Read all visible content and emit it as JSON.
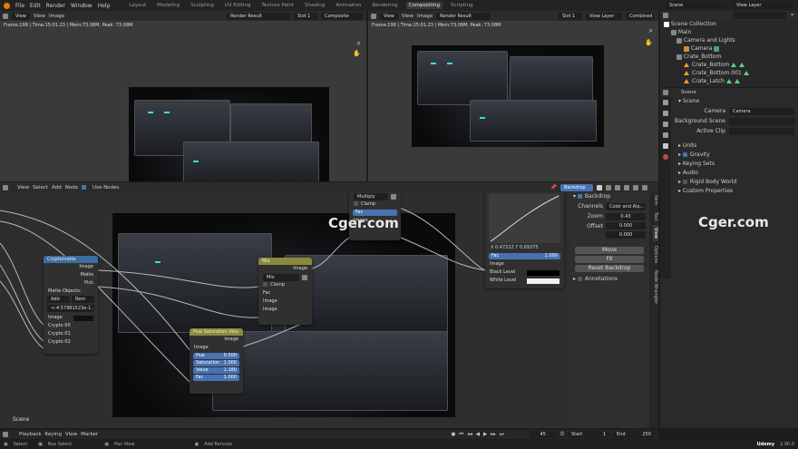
{
  "topbar": {
    "menus": [
      "File",
      "Edit",
      "Render",
      "Window",
      "Help"
    ],
    "workspaces": [
      "Layout",
      "Modeling",
      "Sculpting",
      "UV Editing",
      "Texture Paint",
      "Shading",
      "Animation",
      "Rendering",
      "Compositing",
      "Scripting"
    ],
    "active_workspace": "Compositing",
    "scene": "Scene",
    "view_layer": "View Layer"
  },
  "left_image_editor": {
    "view": "View",
    "menu_view": "View",
    "menu_image": "Image",
    "image_name": "Render Result",
    "slot": "Slot 1",
    "layer": "Composite",
    "status": "Frame:199 | Time:15:01.23 | Mem:73.08M, Peak: 73.08M"
  },
  "right_image_editor": {
    "view": "View",
    "menu_view": "View",
    "menu_image": "Image",
    "image_name": "Render Result",
    "slot": "Slot 1",
    "layer": "View Layer",
    "pass": "Combined",
    "status": "Frame:199 | Time:15:01.23 | Mem:73.08M, Peak: 73.08M"
  },
  "outliner": {
    "title": "Scene Collection",
    "items": [
      "Main",
      "Camera and Lights",
      "Camera",
      "Crate_Bottom",
      "Crate_Bottom",
      "Crate_Bottom.001",
      "Crate_Latch"
    ]
  },
  "properties": {
    "scene_label": "Scene",
    "section": "Scene",
    "camera_label": "Camera",
    "camera_value": "Camera",
    "bg_scene_label": "Background Scene",
    "active_clip_label": "Active Clip",
    "panels": [
      "Units",
      "Gravity",
      "Keying Sets",
      "Audio",
      "Rigid Body World",
      "Custom Properties"
    ]
  },
  "node_editor": {
    "menus": [
      "View",
      "Select",
      "Add",
      "Node"
    ],
    "use_nodes": "Use Nodes",
    "backdrop_btn": "Backdrop",
    "scene_label": "Scene",
    "multiply_node": {
      "title": "Multiply",
      "clamp": "Clamp",
      "fac": "Fac",
      "image": "Image"
    },
    "mix_node": {
      "title": "Mix",
      "output": "Image",
      "mode": "Mix",
      "clamp": "Clamp",
      "fac": "Fac",
      "image1": "Image",
      "image2": "Image"
    },
    "crypto_node": {
      "title": "Cryptomatte",
      "out_image": "Image",
      "out_matte": "Matte",
      "out_pick": "Pick",
      "matte_objects": "Matte Objects:",
      "add": "Add",
      "remove": "Rem",
      "matte_value": "<-4.57981523e-1...",
      "in_image": "Image",
      "crypto00": "Crypto 00",
      "crypto01": "Crypto 01",
      "crypto02": "Crypto 02"
    },
    "hsv_node": {
      "title": "Hue Saturation Valu",
      "out_image": "Image",
      "in_image": "Image",
      "hue_label": "Hue",
      "hue": "0.500",
      "sat_label": "Saturation",
      "sat": "1.000",
      "val_label": "Value",
      "val": "1.180",
      "fac_label": "Fac",
      "fac": "1.000"
    },
    "curves_node": {
      "coords": "X 0.47222   Y 0.69375",
      "fac_label": "Fac",
      "fac": "1.000",
      "image": "Image",
      "black": "Black Level",
      "white": "White Level"
    }
  },
  "sidebar": {
    "tabs": [
      "Item",
      "Tool",
      "View",
      "Options",
      "Node Wrangler"
    ],
    "backdrop": "Backdrop",
    "channels_label": "Channels",
    "channels_value": "Color and Alp...",
    "zoom_label": "Zoom",
    "zoom": "0.43",
    "offset_label": "Offset",
    "offset_x": "0.000",
    "offset_y": "0.000",
    "move": "Move",
    "fit": "Fit",
    "reset": "Reset Backdrop",
    "annotations": "Annotations"
  },
  "timeline": {
    "menus": [
      "Playback",
      "Keying",
      "View",
      "Marker"
    ],
    "current_frame": "45",
    "start_label": "Start",
    "start": "1",
    "end_label": "End",
    "end": "250"
  },
  "statusbar": {
    "select": "Select",
    "box_select": "Box Select",
    "pan_view": "Pan View",
    "add_reroute": "Add Reroute",
    "watermark_udemy": "Udemy",
    "version": "2.90.0"
  },
  "watermark": "Cger.com",
  "colors": {
    "accent": "#4772b3",
    "active_ws": "#3a3a3a",
    "socket_yellow": "#c7c729",
    "led_cyan": "#36e3d4"
  }
}
